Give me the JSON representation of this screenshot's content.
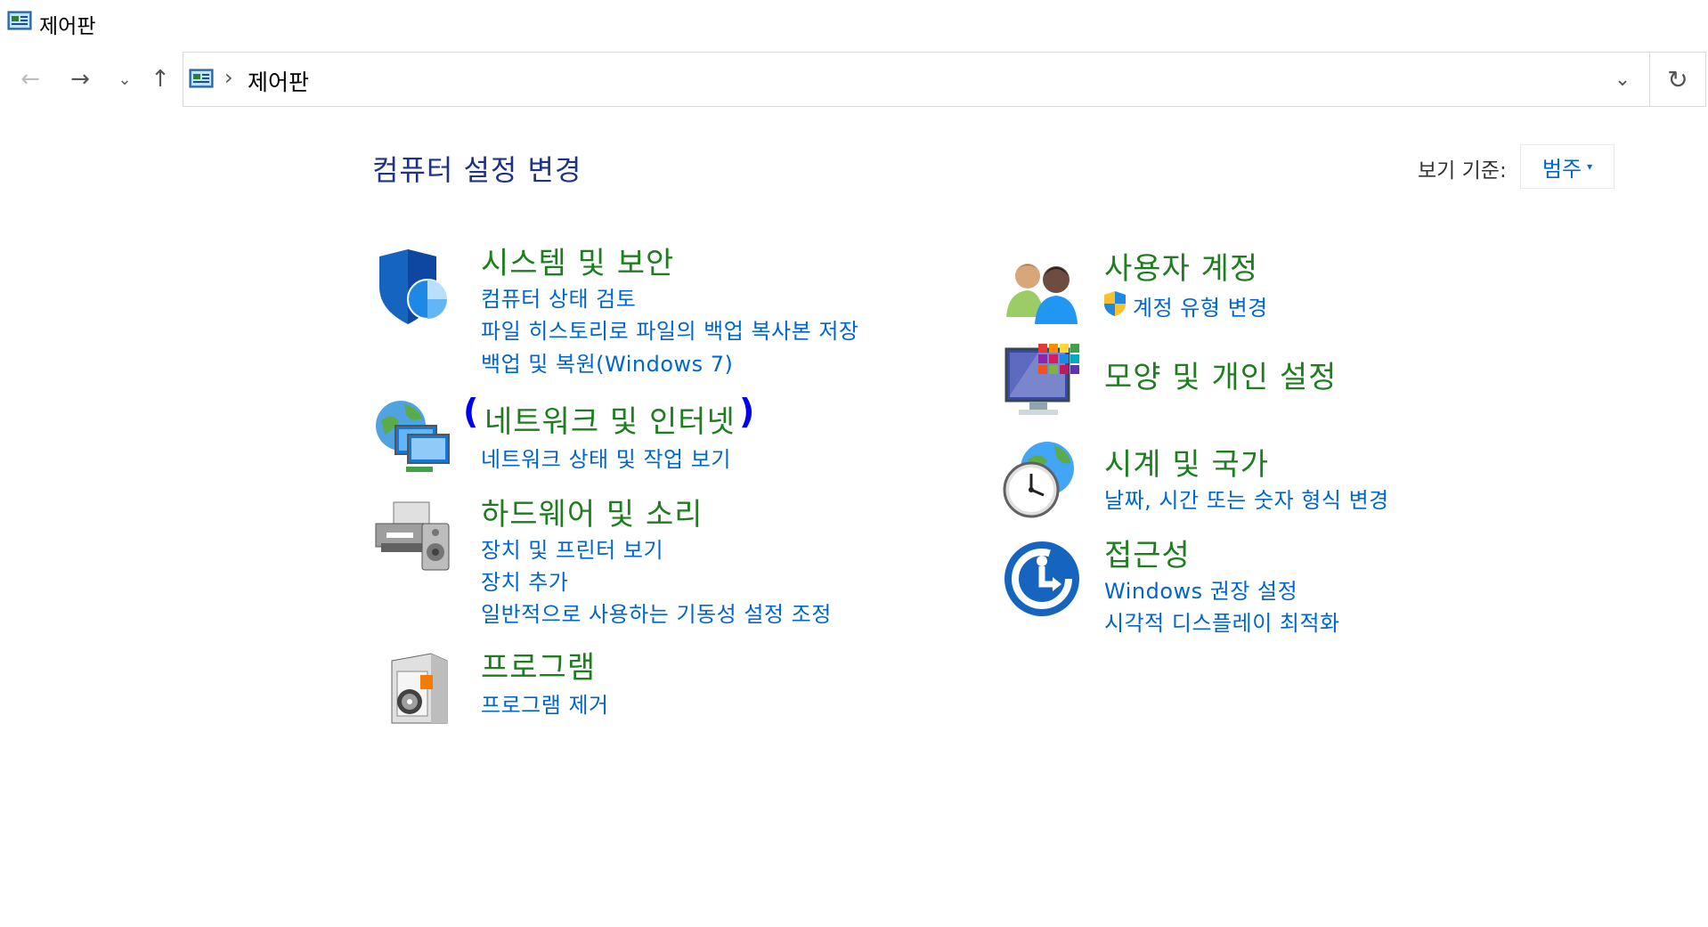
{
  "window": {
    "title": "제어판"
  },
  "nav": {
    "back_icon": "←",
    "forward_icon": "→",
    "recent_icon": "⌄",
    "up_icon": "↑",
    "address_separator": "›",
    "address_text": "제어판",
    "dropdown_icon": "⌄",
    "refresh_icon": "↻"
  },
  "main": {
    "page_title": "컴퓨터 설정 변경",
    "view_by_label": "보기 기준:",
    "view_by_value": "범주",
    "view_by_caret": "▾"
  },
  "categories": {
    "system_security": {
      "title": "시스템 및 보안",
      "links": [
        "컴퓨터 상태 검토",
        "파일 히스토리로 파일의 백업 복사본 저장",
        "백업 및 복원(Windows 7)"
      ]
    },
    "network": {
      "title": "네트워크 및 인터넷",
      "paren_open": "(",
      "paren_close": ")",
      "links": [
        "네트워크 상태 및 작업 보기"
      ]
    },
    "hardware": {
      "title": "하드웨어 및 소리",
      "links": [
        "장치 및 프린터 보기",
        "장치 추가",
        "일반적으로 사용하는 기동성 설정 조정"
      ]
    },
    "programs": {
      "title": "프로그램",
      "links": [
        "프로그램 제거"
      ]
    },
    "user_accounts": {
      "title": "사용자 계정",
      "links": [
        "계정 유형 변경"
      ]
    },
    "appearance": {
      "title": "모양 및 개인 설정",
      "links": []
    },
    "clock_region": {
      "title": "시계 및 국가",
      "links": [
        "날짜, 시간 또는 숫자 형식 변경"
      ]
    },
    "ease_of_access": {
      "title": "접근성",
      "links": [
        "Windows 권장 설정",
        "시각적 디스플레이 최적화"
      ]
    }
  },
  "colors": {
    "category_title": "#1e7d1e",
    "link": "#0066cc",
    "page_title": "#1e3287"
  }
}
